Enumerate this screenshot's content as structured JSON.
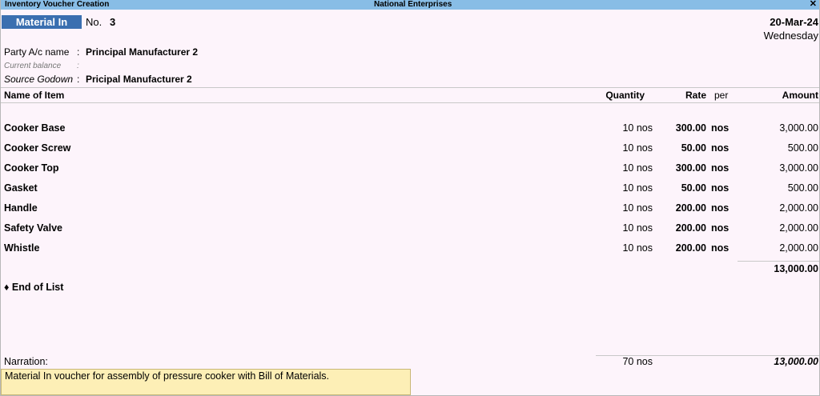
{
  "window": {
    "title": "Inventory Voucher Creation",
    "company": "National Enterprises",
    "close_glyph": "✕"
  },
  "voucher": {
    "type": "Material In",
    "no_label": "No.",
    "no": "3",
    "date": "20-Mar-24",
    "day": "Wednesday"
  },
  "fields": {
    "party_label": "Party A/c name",
    "party_value": "Principal Manufacturer 2",
    "balance_label": "Current balance",
    "godown_label": "Source Godown",
    "godown_value": "Pricipal Manufacturer 2",
    "colon": ":"
  },
  "columns": {
    "name": "Name of Item",
    "quantity": "Quantity",
    "rate": "Rate",
    "per": "per",
    "amount": "Amount"
  },
  "items": [
    {
      "name": "Cooker Base",
      "qty": "10 nos",
      "rate": "300.00",
      "per": "nos",
      "amount": "3,000.00"
    },
    {
      "name": "Cooker Screw",
      "qty": "10 nos",
      "rate": "50.00",
      "per": "nos",
      "amount": "500.00"
    },
    {
      "name": "Cooker Top",
      "qty": "10 nos",
      "rate": "300.00",
      "per": "nos",
      "amount": "3,000.00"
    },
    {
      "name": "Gasket",
      "qty": "10 nos",
      "rate": "50.00",
      "per": "nos",
      "amount": "500.00"
    },
    {
      "name": "Handle",
      "qty": "10 nos",
      "rate": "200.00",
      "per": "nos",
      "amount": "2,000.00"
    },
    {
      "name": "Safety Valve",
      "qty": "10 nos",
      "rate": "200.00",
      "per": "nos",
      "amount": "2,000.00"
    },
    {
      "name": "Whistle",
      "qty": "10 nos",
      "rate": "200.00",
      "per": "nos",
      "amount": "2,000.00"
    }
  ],
  "subtotal": "13,000.00",
  "end_of_list": "♦ End of List",
  "totals": {
    "narration_label": "Narration:",
    "qty": "70 nos",
    "amount": "13,000.00"
  },
  "narration": "Material In voucher for assembly of pressure cooker with Bill of Materials.",
  "colors": {
    "title_bar": "#88bde6",
    "voucher_type_bg": "#3a6fb0",
    "background": "#fdf4fb",
    "narration_bg": "#fdefb6"
  }
}
